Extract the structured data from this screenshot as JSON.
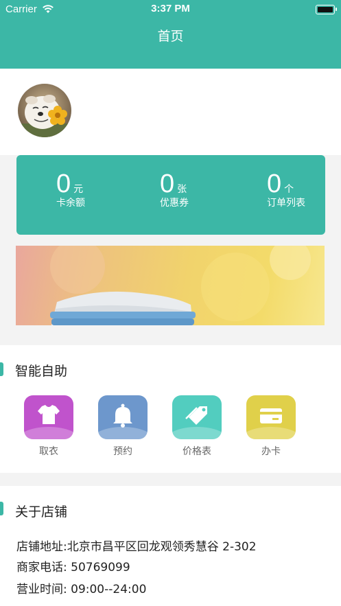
{
  "status_bar": {
    "carrier": "Carrier",
    "time": "3:37 PM"
  },
  "header": {
    "title": "首页"
  },
  "stats": [
    {
      "value": "0",
      "unit": "元",
      "label": "卡余额"
    },
    {
      "value": "0",
      "unit": "张",
      "label": "优惠券"
    },
    {
      "value": "0",
      "unit": "个",
      "label": "订单列表"
    }
  ],
  "smart_section": {
    "title": "智能自助",
    "items": [
      {
        "label": "取衣",
        "icon": "shirt-icon",
        "color": "#c053cc"
      },
      {
        "label": "预约",
        "icon": "bell-icon",
        "color": "#6d97cc"
      },
      {
        "label": "价格表",
        "icon": "price-tag-icon",
        "color": "#52cdbf"
      },
      {
        "label": "办卡",
        "icon": "card-icon",
        "color": "#e0d04a"
      }
    ]
  },
  "store_section": {
    "title": "关于店铺",
    "address": "店铺地址:北京市昌平区回龙观领秀慧谷 2-302",
    "phone": "商家电话: 50769099",
    "hours": "营业时间: 09:00--24:00"
  },
  "colors": {
    "accent": "#3cb7a6"
  }
}
